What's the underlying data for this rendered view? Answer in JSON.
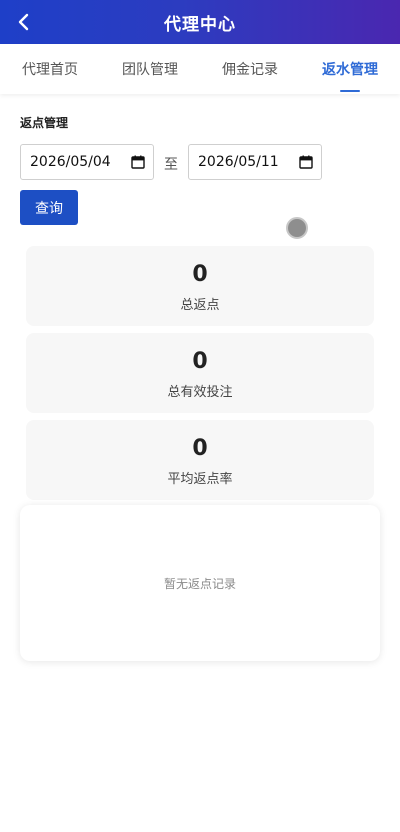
{
  "header": {
    "title": "代理中心",
    "back_icon": "chevron-left-icon",
    "gradient": [
      "#1e3fc8",
      "#4a27b0"
    ]
  },
  "tabs": [
    {
      "label": "代理首页",
      "active": false
    },
    {
      "label": "团队管理",
      "active": false
    },
    {
      "label": "佣金记录",
      "active": false
    },
    {
      "label": "返水管理",
      "active": true
    }
  ],
  "filter": {
    "section_title": "返点管理",
    "start_date": "2026/05/04",
    "separator": "至",
    "end_date": "2026/05/11",
    "calendar_icon": "calendar-icon",
    "query_label": "查询"
  },
  "stats": [
    {
      "value": "0",
      "label": "总返点"
    },
    {
      "value": "0",
      "label": "总有效投注"
    },
    {
      "value": "0",
      "label": "平均返点率"
    }
  ],
  "empty": {
    "text": "暂无返点记录"
  },
  "colors": {
    "accent": "#2f6bd6",
    "button": "#1d4fc4",
    "card_bg": "#f7f7f7"
  }
}
